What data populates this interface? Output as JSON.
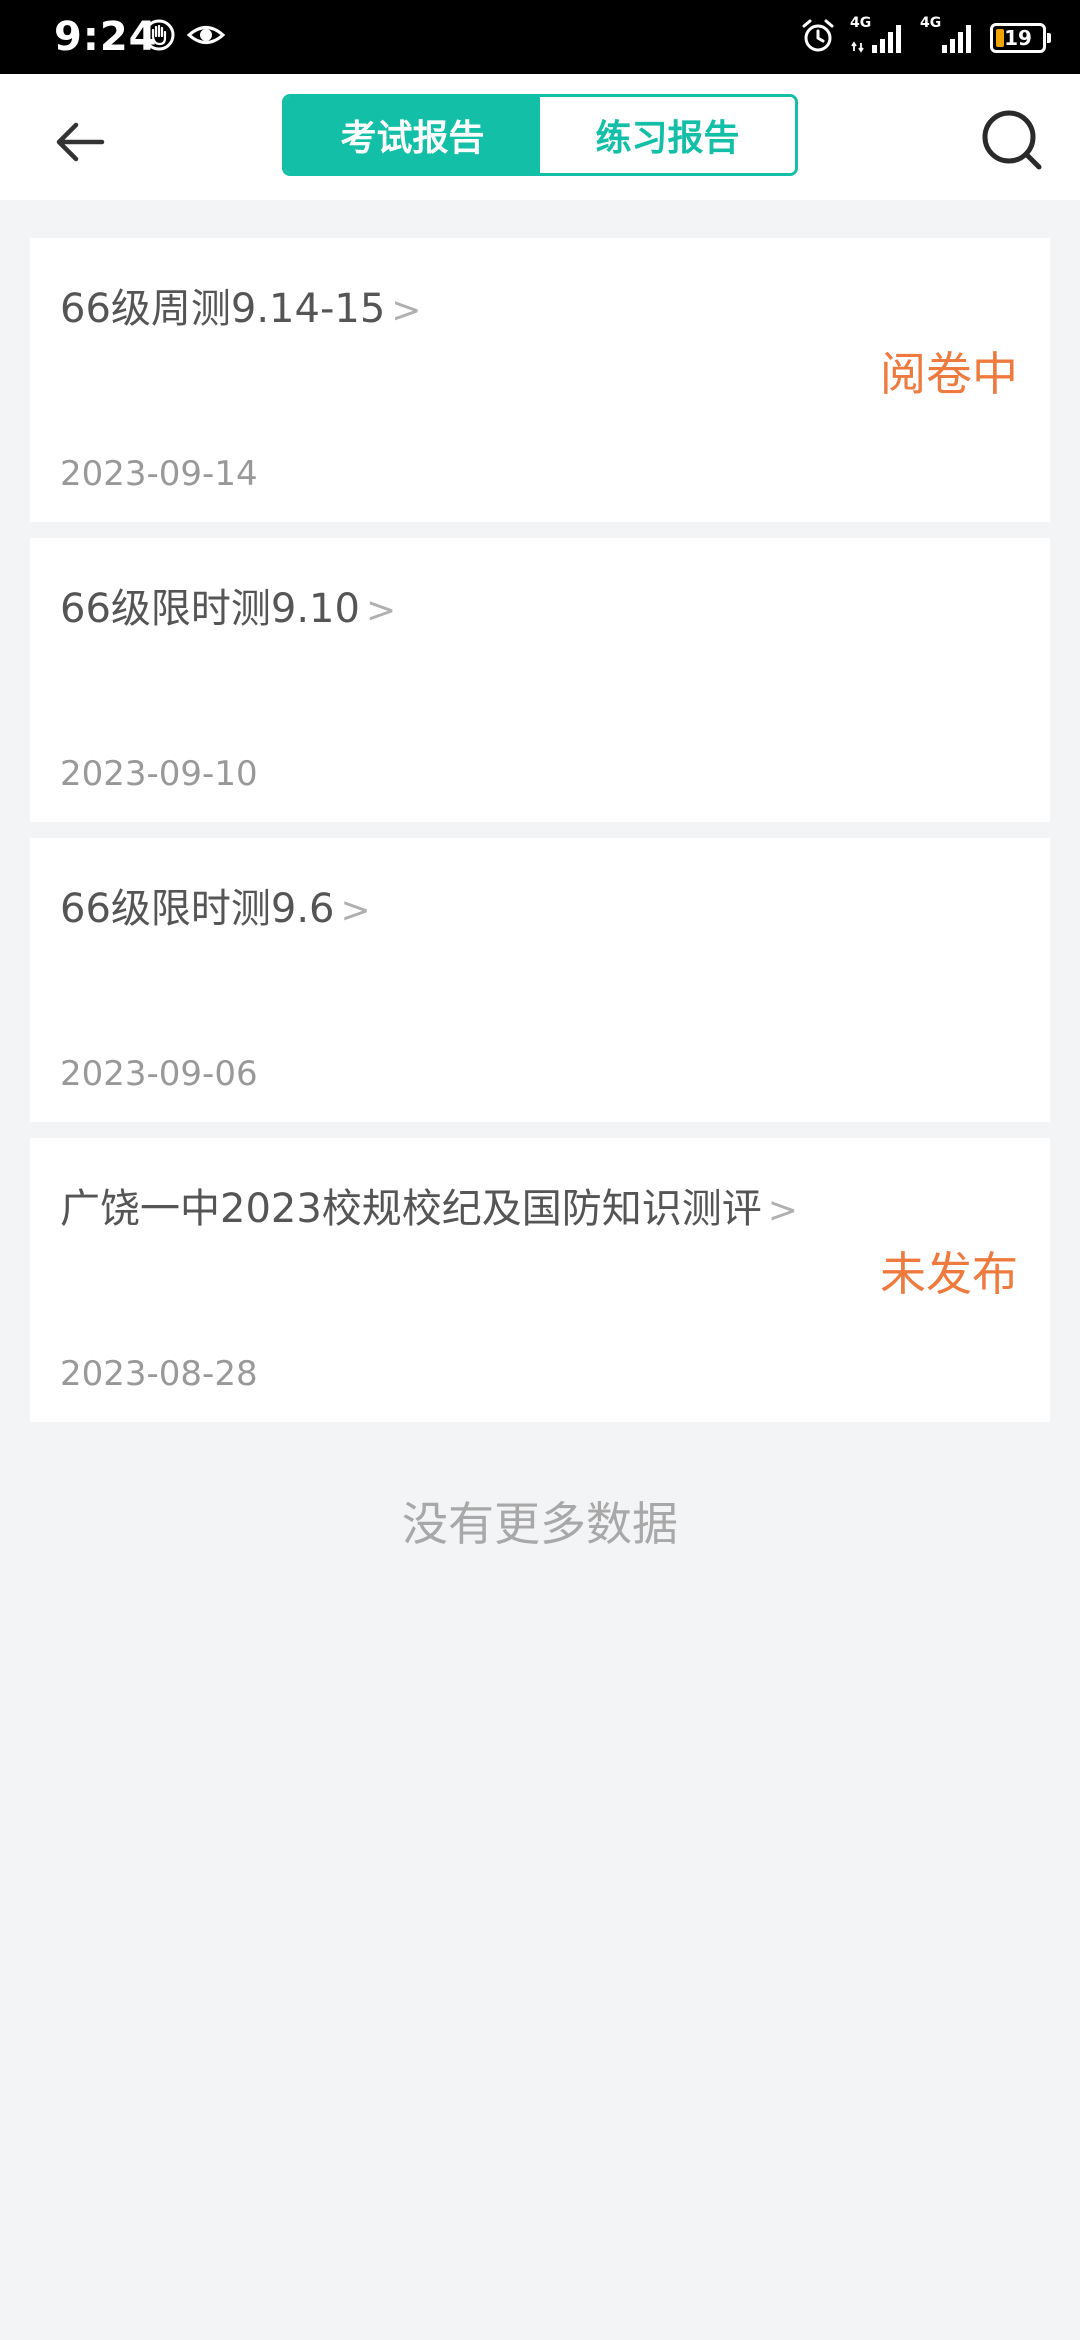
{
  "status_bar": {
    "time": "9:24",
    "network_1": "4G",
    "network_2": "4G",
    "battery": "19"
  },
  "header": {
    "tabs": [
      {
        "label": "考试报告",
        "active": true
      },
      {
        "label": "练习报告",
        "active": false
      }
    ]
  },
  "reports": [
    {
      "title": "66级周测9.14-15",
      "chevron": ">",
      "status": "阅卷中",
      "date": "2023-09-14"
    },
    {
      "title": "66级限时测9.10",
      "chevron": ">",
      "status": "",
      "date": "2023-09-10"
    },
    {
      "title": "66级限时测9.6",
      "chevron": ">",
      "status": "",
      "date": "2023-09-06"
    },
    {
      "title": "广饶一中2023校规校纪及国防知识测评",
      "chevron": ">",
      "status": "未发布",
      "date": "2023-08-28"
    }
  ],
  "footer": {
    "no_more_text": "没有更多数据"
  },
  "colors": {
    "accent": "#13bfa6",
    "status": "#ee7a3e",
    "background": "#f3f4f6"
  }
}
